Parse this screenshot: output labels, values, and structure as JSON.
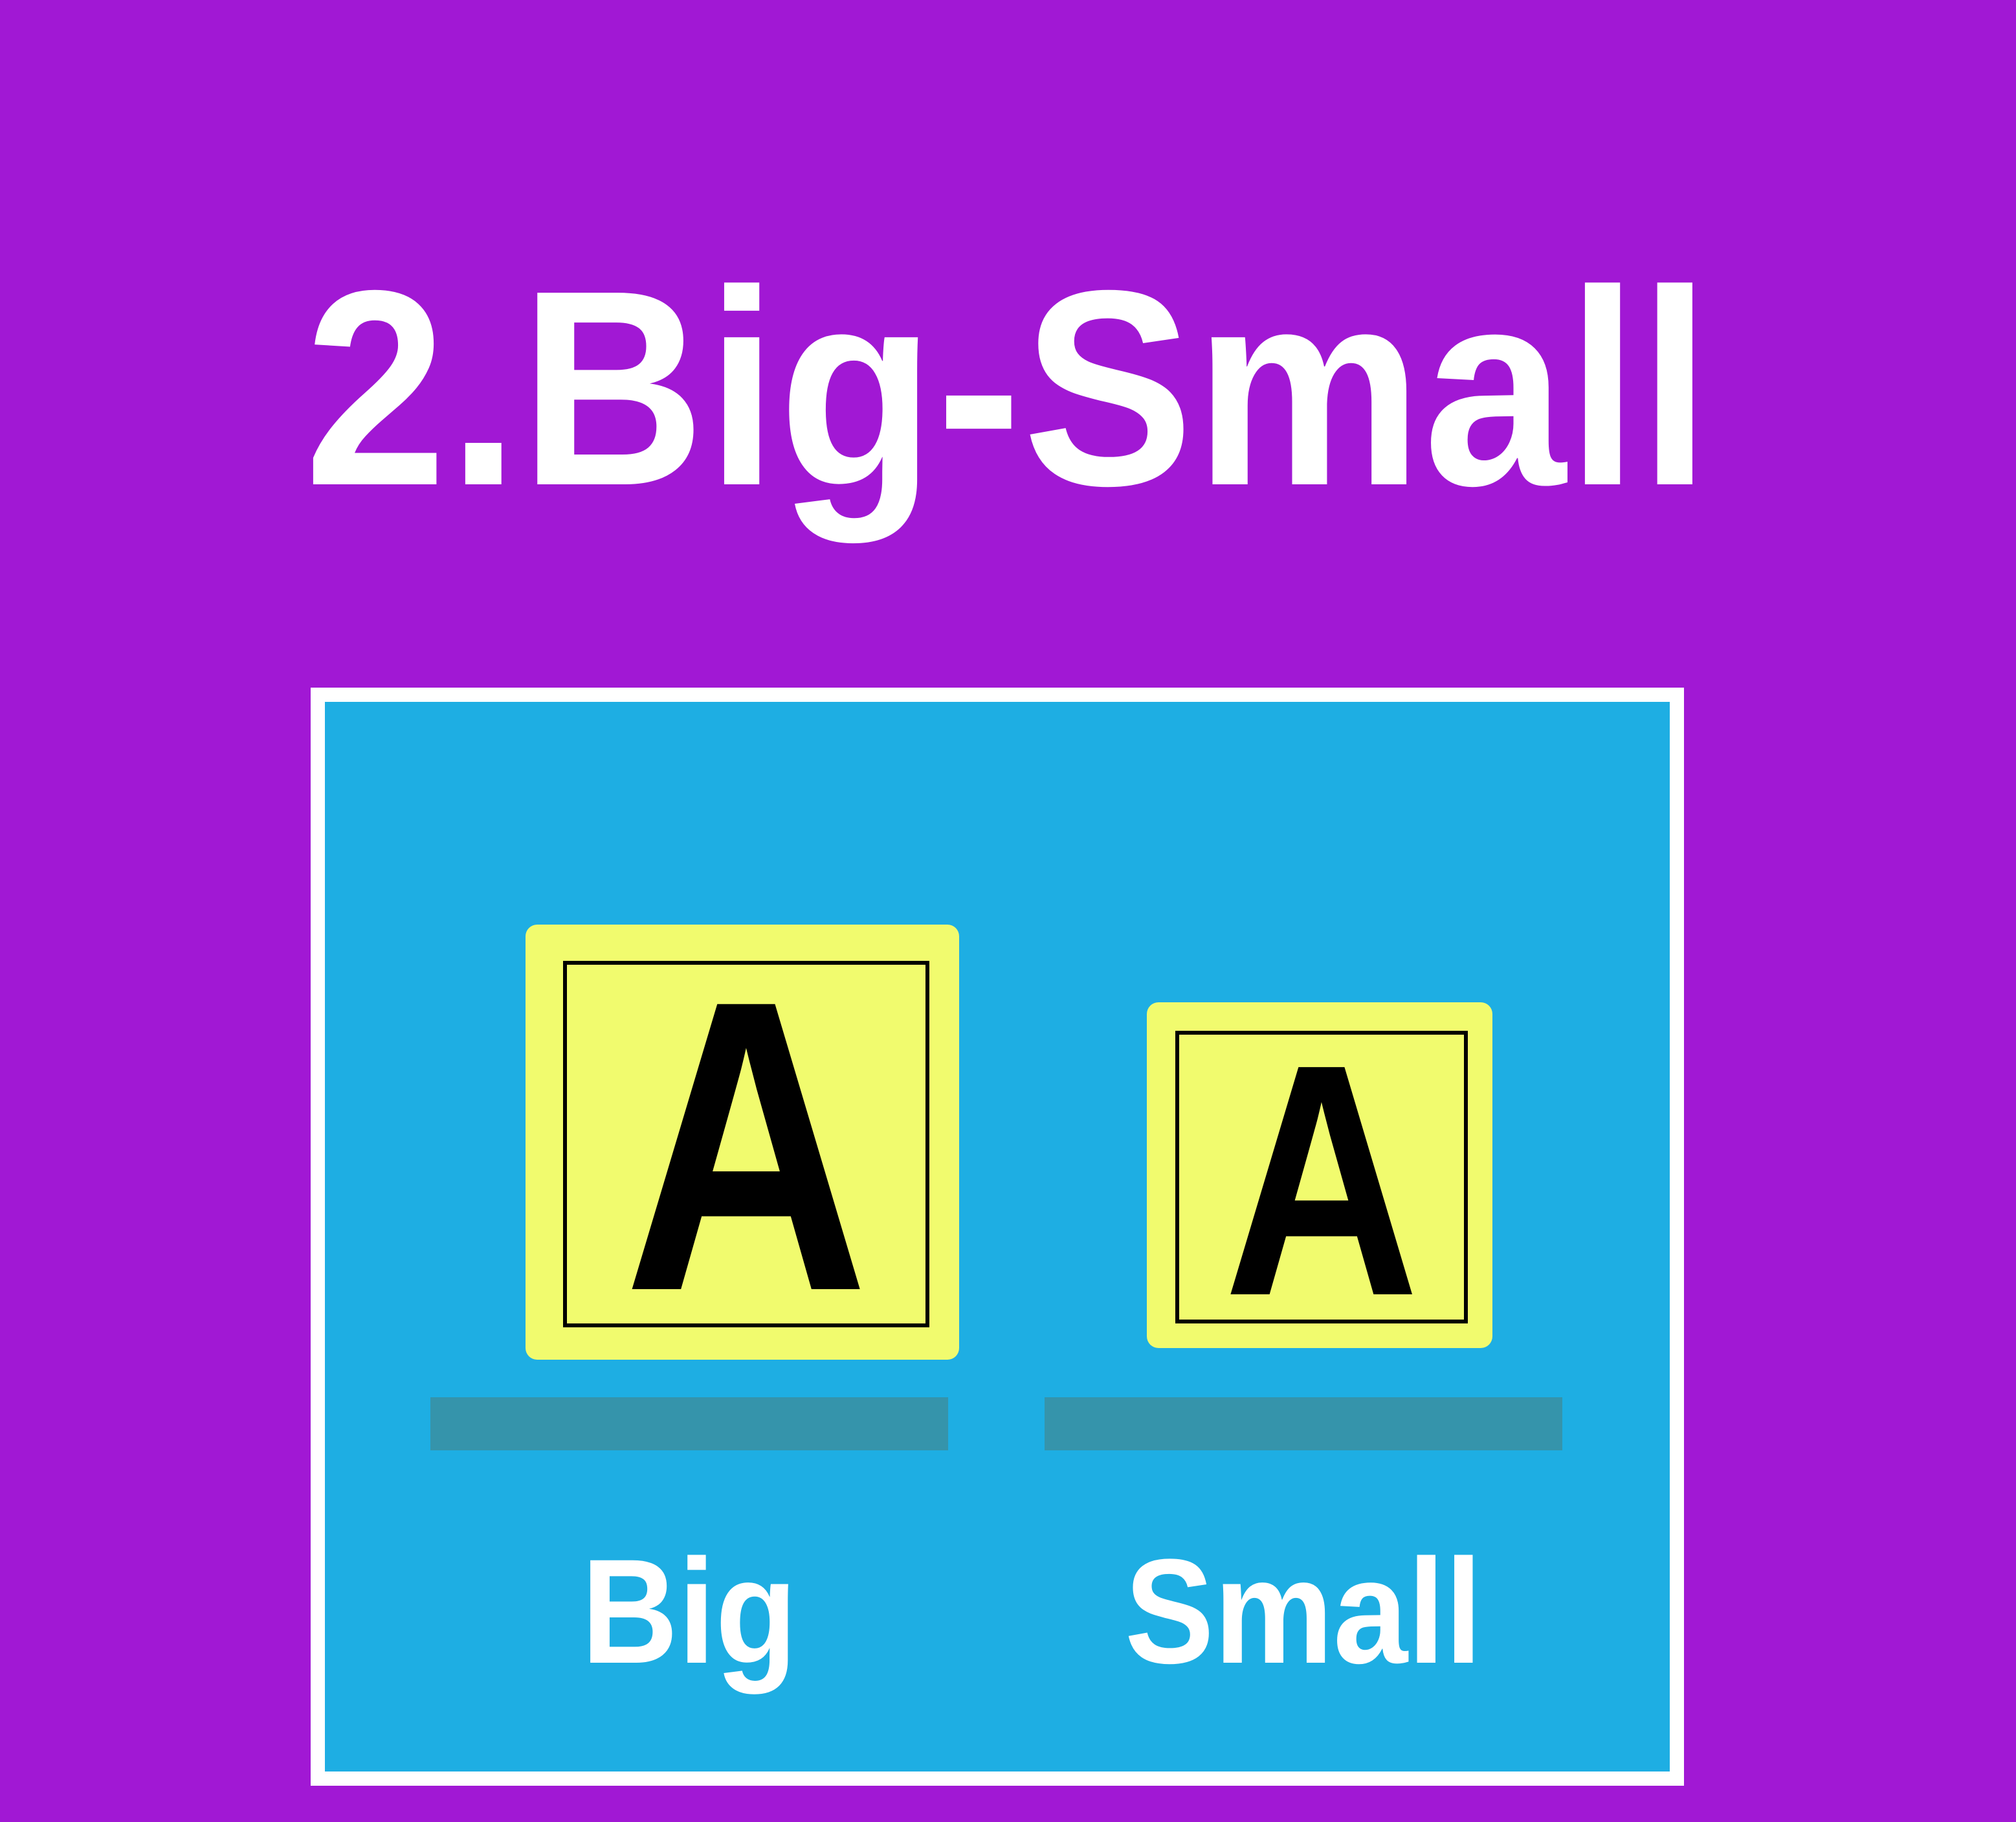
{
  "title": "2.Big-Small",
  "colors": {
    "background": "#a118d4",
    "panel": "#1eaee3",
    "panel_border": "#ffffff",
    "card": "#f1fb6e",
    "glyph": "#000000",
    "bar": "#3594ab",
    "text": "#ffffff"
  },
  "items": [
    {
      "glyph": "A",
      "label": "Big"
    },
    {
      "glyph": "A",
      "label": "Small"
    }
  ]
}
